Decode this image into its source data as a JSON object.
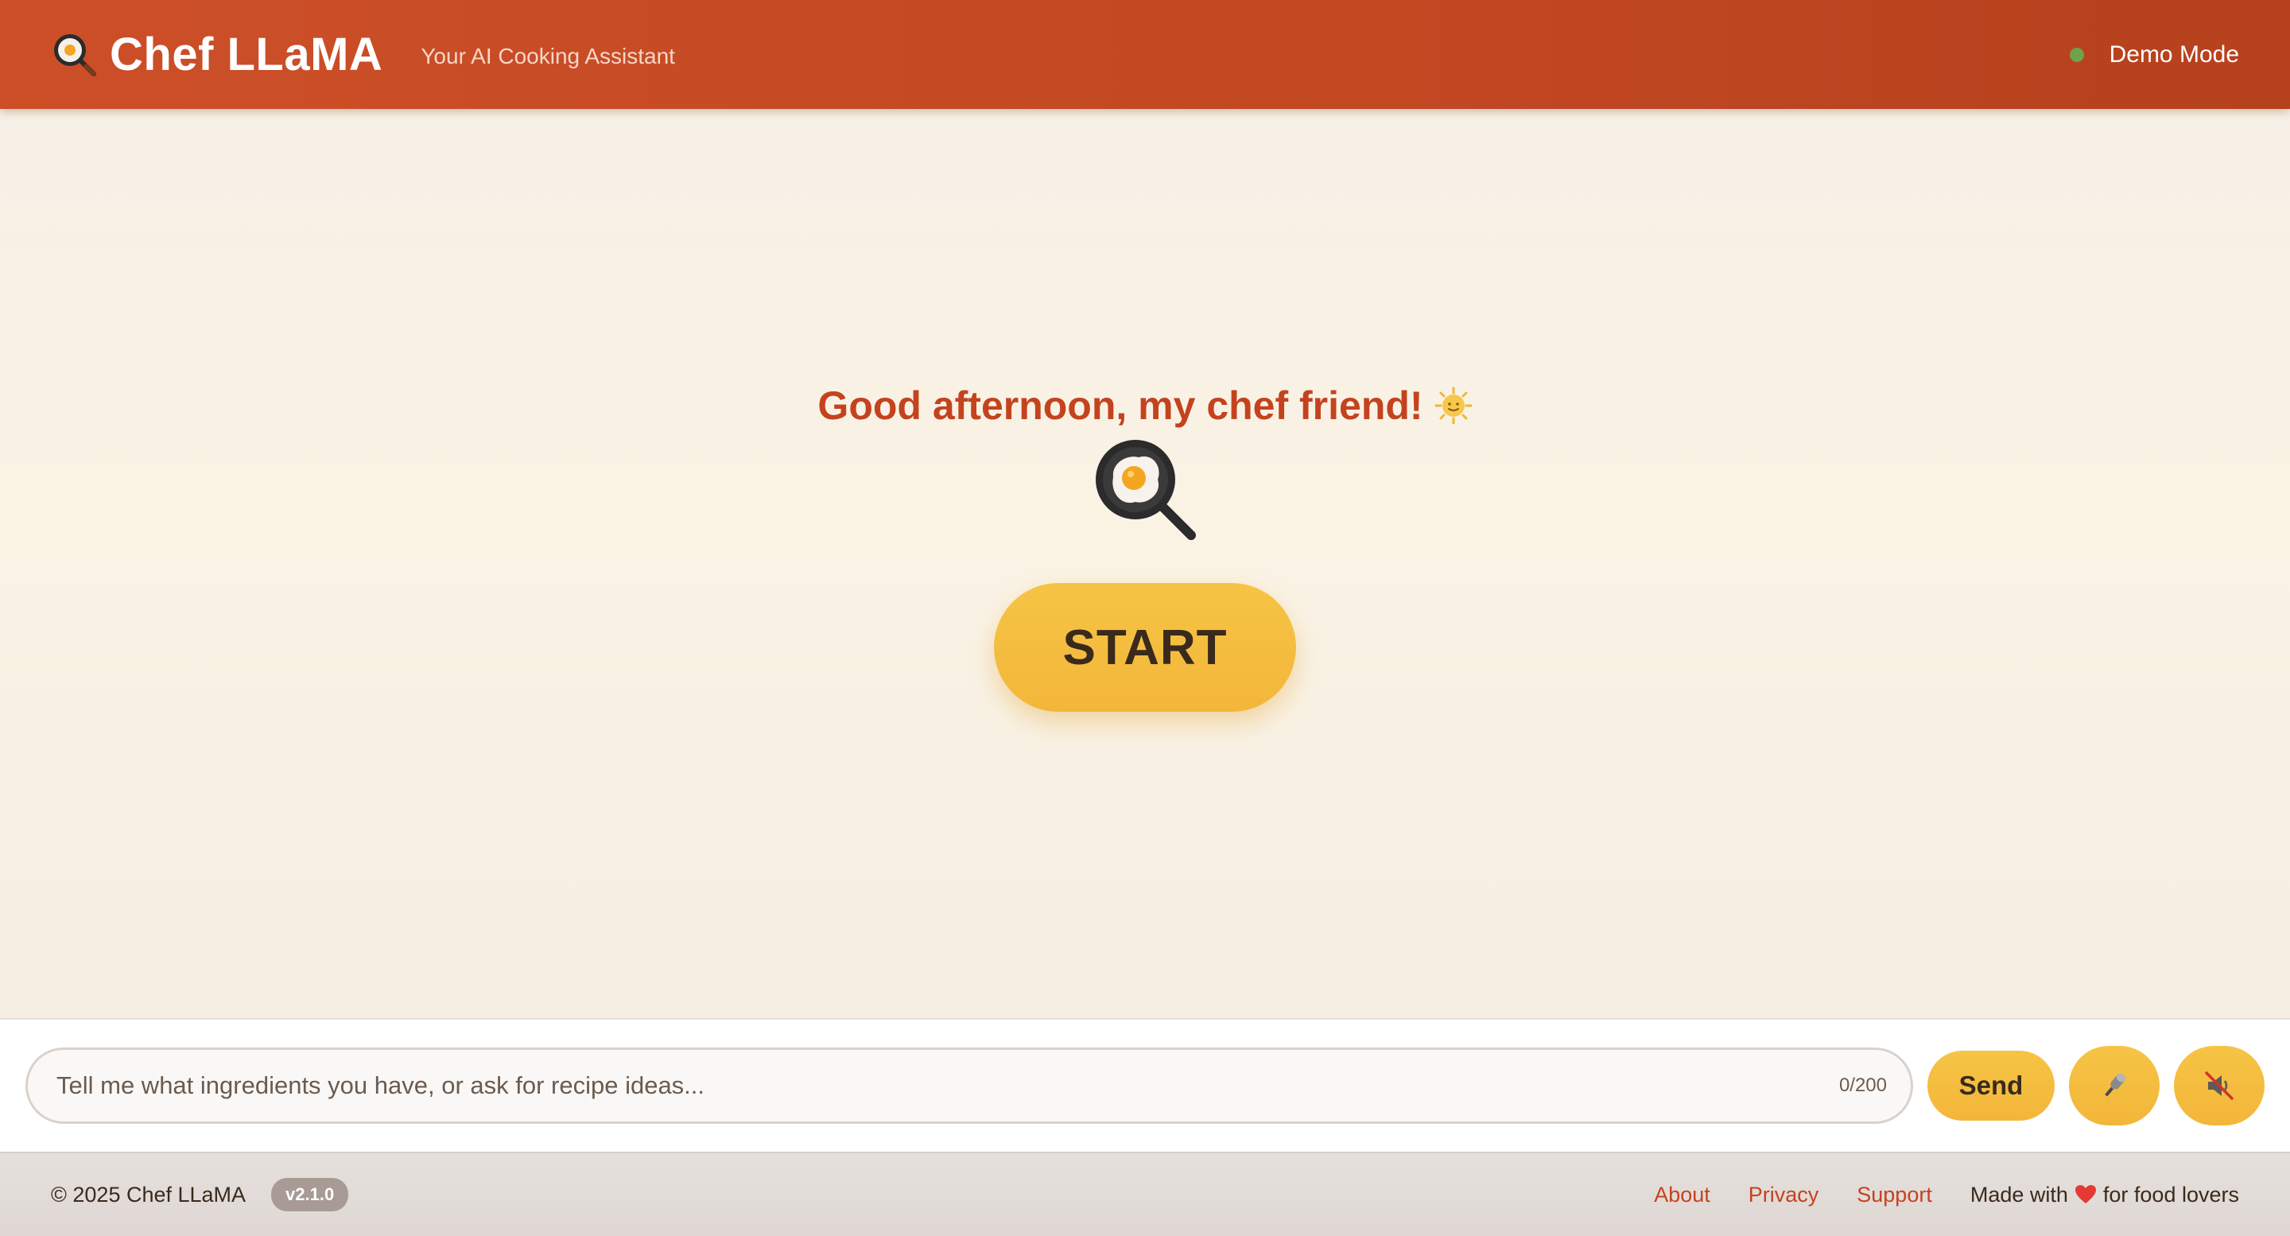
{
  "header": {
    "app_title": "Chef LLaMA",
    "tagline": "Your AI Cooking Assistant",
    "status_text": "Demo Mode",
    "status_color": "#6ea24b",
    "logo_icon": "frying-pan-egg-icon"
  },
  "main": {
    "greeting": "Good afternoon, my chef friend!",
    "greeting_icon": "sun-face-icon",
    "hero_icon": "frying-pan-egg-icon",
    "start_label": "START"
  },
  "composer": {
    "placeholder": "Tell me what ingredients you have, or ask for recipe ideas...",
    "value": "",
    "char_count": "0/200",
    "send_label": "Send",
    "mic_icon": "microphone-icon",
    "mute_icon": "speaker-muted-icon"
  },
  "footer": {
    "copyright": "© 2025 Chef LLaMA",
    "version": "v2.1.0",
    "links": [
      "About",
      "Privacy",
      "Support"
    ],
    "made_with_prefix": "Made with",
    "made_with_suffix": "for food lovers",
    "heart_icon": "heart-icon"
  },
  "colors": {
    "brand": "#c4431f",
    "accent": "#f6c445",
    "background": "#f7f1e7"
  }
}
